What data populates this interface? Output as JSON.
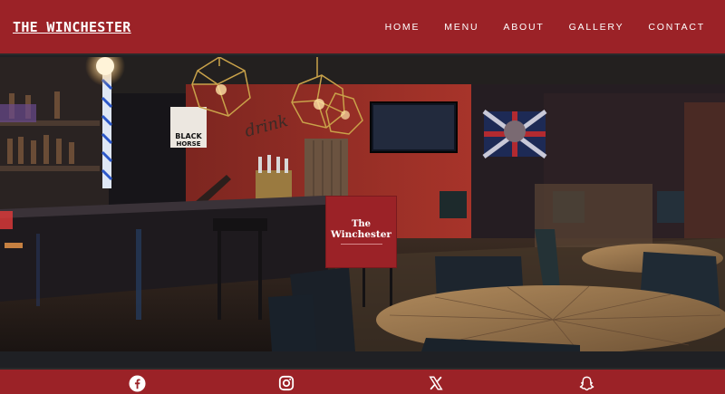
{
  "header": {
    "brand": "THE WINCHESTER",
    "nav": [
      "HOME",
      "MENU",
      "ABOUT",
      "GALLERY",
      "CONTACT"
    ]
  },
  "hero": {
    "logo_line1": "The",
    "logo_line2": "Winchester",
    "neon_sign": "drink",
    "poster_text": "BLACK HORSE"
  },
  "footer": {
    "icons": [
      "facebook-icon",
      "instagram-icon",
      "x-icon",
      "snapchat-icon"
    ]
  },
  "colors": {
    "brand_red": "#9b2227",
    "dark_bg": "#1f2024"
  }
}
